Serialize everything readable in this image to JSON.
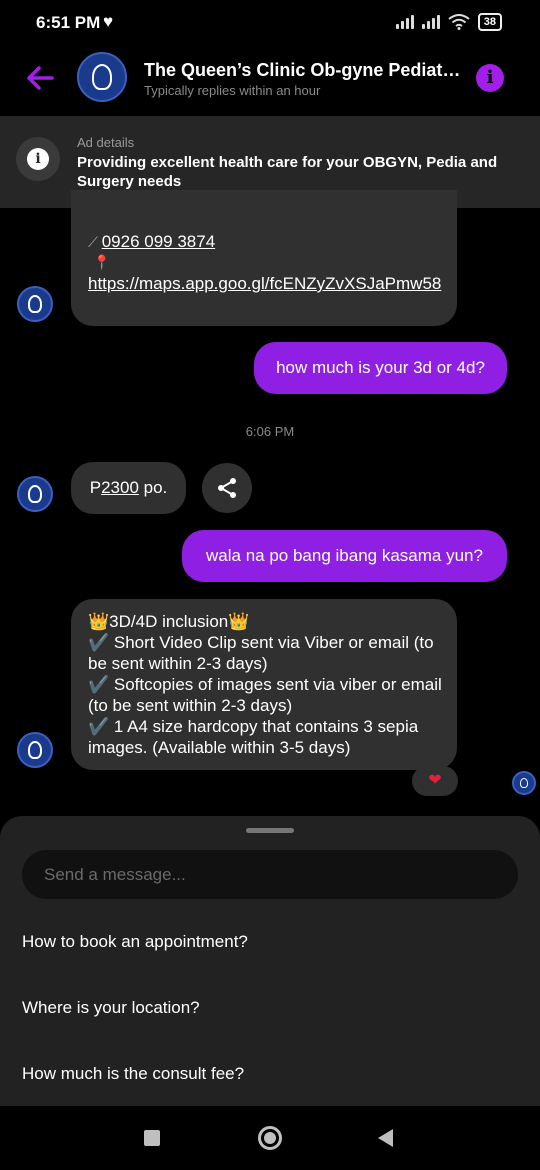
{
  "status_bar": {
    "time": "6:51 PM",
    "battery": "38",
    "icons": [
      "heart-icon",
      "signal-icon",
      "signal-icon",
      "wifi-icon",
      "battery-icon"
    ]
  },
  "header": {
    "title": "The Queen’s Clinic Ob-gyne Pediatric...",
    "subtitle": "Typically replies within an hour",
    "accent_color": "#a31ee8"
  },
  "ad": {
    "label": "Ad details",
    "text": "Providing excellent  health care for your OBGYN, Pedia and Surgery needs"
  },
  "messages": {
    "m1_phone": "0926 099 3874",
    "m1_pin": "📍",
    "m1_url": "https://maps.app.goo.gl/fcENZyZvXSJaPmw58",
    "m2": "how much is your 3d or 4d?",
    "time_separator": "6:06 PM",
    "m3_prefix": "P",
    "m3_amount": "2300",
    "m3_suffix": " po.",
    "m4": "wala na po bang ibang kasama yun?",
    "m5_lines": [
      "👑3D/4D inclusion👑",
      "✔️ Short Video Clip sent via Viber or email (to be sent within 2-3 days)",
      "✔️ Softcopies of images sent via viber or email (to be sent within 2-3 days)",
      "✔️ 1 A4 size hardcopy that contains 3 sepia images. (Available within 3-5 days)"
    ],
    "reaction": "❤"
  },
  "composer": {
    "placeholder": "Send a message..."
  },
  "quick_replies": [
    "How to book an appointment?",
    "Where is your location?",
    "How much is the consult fee?"
  ]
}
